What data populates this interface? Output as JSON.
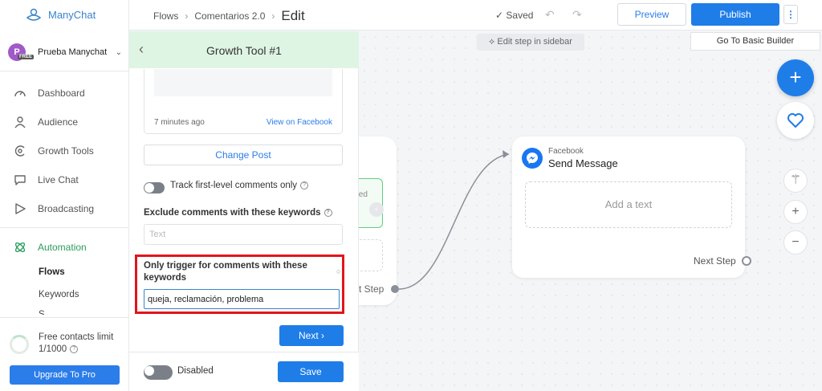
{
  "brand": {
    "name": "ManyChat"
  },
  "account": {
    "initial": "P",
    "badge": "FREE",
    "name": "Prueba Manychat"
  },
  "nav": [
    {
      "label": "Dashboard",
      "icon": "dashboard-icon"
    },
    {
      "label": "Audience",
      "icon": "person-icon"
    },
    {
      "label": "Growth Tools",
      "icon": "growth-tools-icon"
    },
    {
      "label": "Live Chat",
      "icon": "chat-bubble-icon"
    },
    {
      "label": "Broadcasting",
      "icon": "send-icon"
    },
    {
      "label": "Automation",
      "icon": "automation-icon",
      "active": true
    }
  ],
  "automation_sub": [
    "Flows",
    "Keywords",
    "S..."
  ],
  "contacts_limit": {
    "label": "Free contacts limit",
    "value": "1/1000"
  },
  "upgrade_label": "Upgrade To Pro",
  "topbar": {
    "breadcrumb": [
      "Flows",
      "Comentarios 2.0",
      "Edit"
    ],
    "saved": "Saved",
    "preview": "Preview",
    "publish": "Publish",
    "more": "⋮",
    "basic_builder": "Go To Basic Builder"
  },
  "canvas": {
    "edit_step_chip": "Edit step in sidebar",
    "left_node": {
      "badge_fragment": "bled",
      "next_fragment": "t Step"
    },
    "send_node": {
      "platform": "Facebook",
      "title": "Send Message",
      "placeholder": "Add a text",
      "next_step": "Next Step"
    }
  },
  "panel": {
    "title": "Growth Tool #1",
    "post": {
      "time": "7 minutes ago",
      "link": "View on Facebook"
    },
    "change_post": "Change Post",
    "track_label": "Track first-level comments only",
    "exclude_label": "Exclude comments with these keywords",
    "exclude_placeholder": "Text",
    "only_trigger_label": "Only trigger for comments with these keywords",
    "keywords_value": "queja, reclamación, problema",
    "next": "Next",
    "disabled_label": "Disabled",
    "save": "Save"
  },
  "colors": {
    "accent": "#1f7de8",
    "brand_green": "#2a9d5c",
    "highlight_red": "#e3141c",
    "panel_header": "#dff5e4"
  }
}
